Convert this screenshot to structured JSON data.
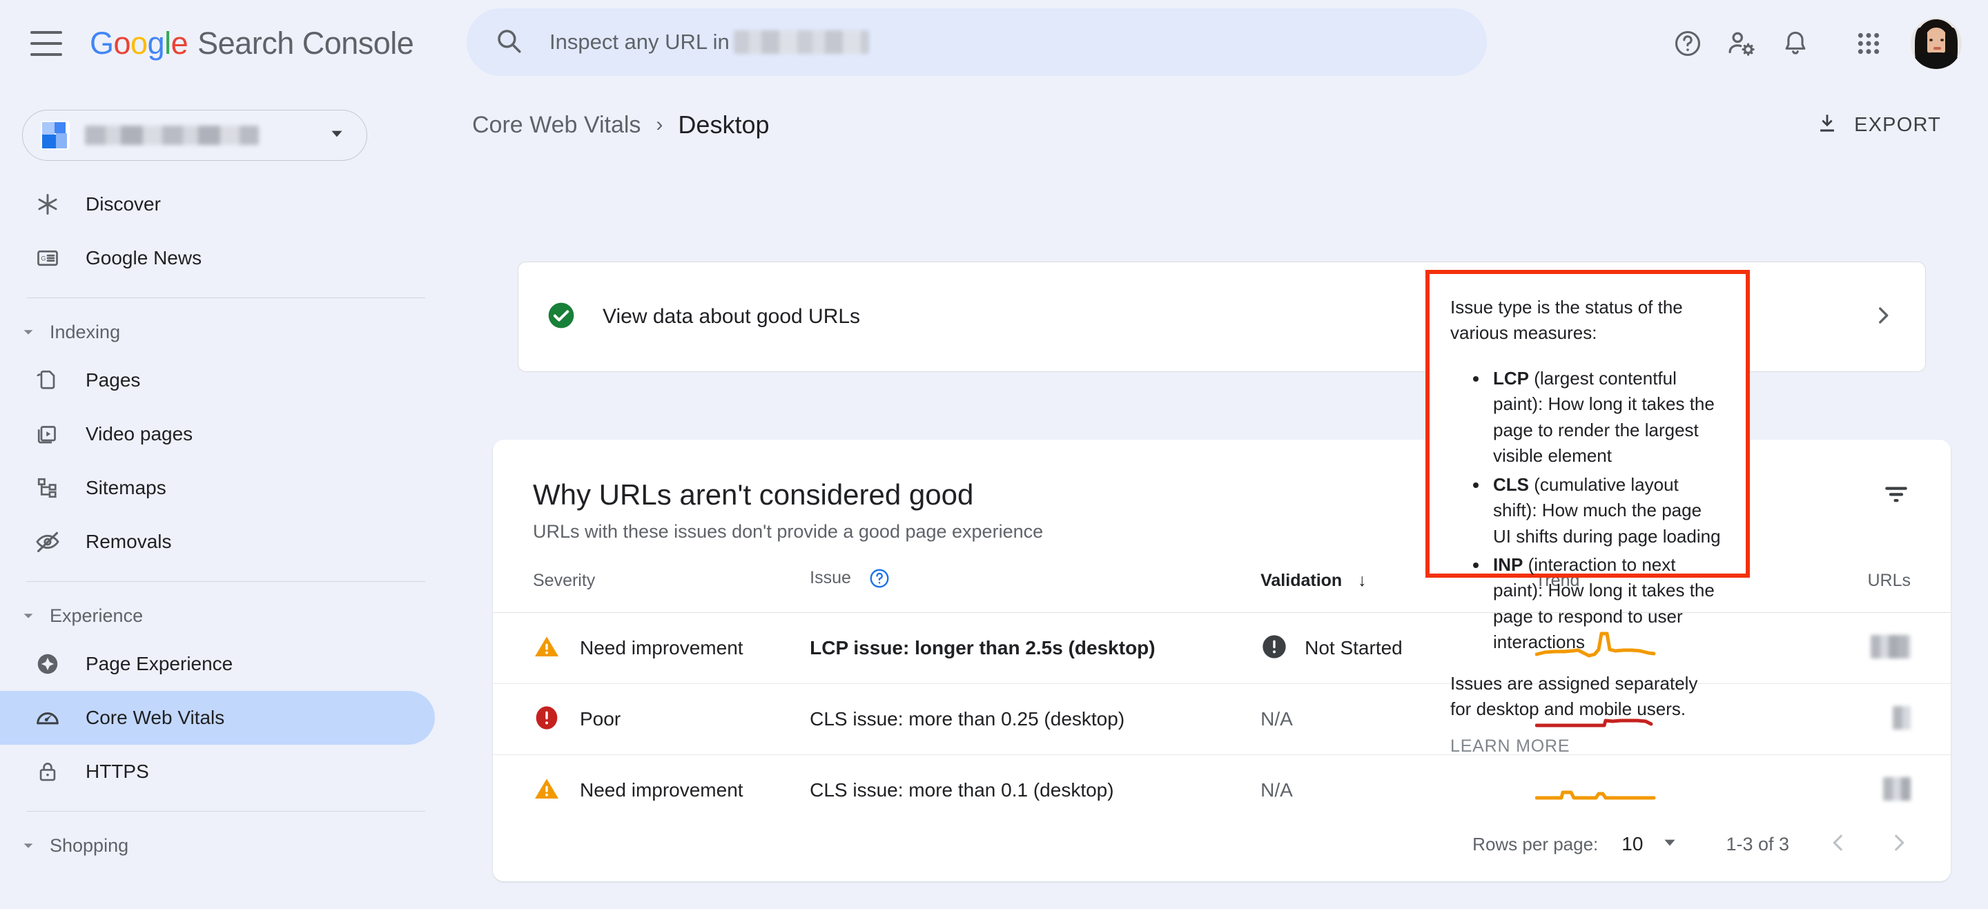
{
  "header": {
    "menu_icon": "hamburger-menu-icon",
    "logo_google": "Google",
    "logo_product": "Search Console",
    "search": {
      "prefix": "Inspect any URL in ",
      "redacted": true,
      "icon": "search-icon"
    },
    "icons": [
      "help-icon",
      "user-settings-icon",
      "notifications-bell-icon",
      "apps-grid-icon"
    ],
    "avatar": "user-avatar"
  },
  "sidebar": {
    "property_selector": {
      "redacted": true,
      "caret": "chevron-down-icon"
    },
    "items": [
      {
        "label": "Discover",
        "icon": "discover-asterisk-icon",
        "active": false
      },
      {
        "label": "Google News",
        "icon": "google-news-icon",
        "active": false
      }
    ],
    "groups": [
      {
        "label": "Indexing",
        "caret": "chevron-down-icon",
        "items": [
          {
            "label": "Pages",
            "icon": "pages-icon",
            "active": false
          },
          {
            "label": "Video pages",
            "icon": "video-pages-icon",
            "active": false
          },
          {
            "label": "Sitemaps",
            "icon": "sitemaps-icon",
            "active": false
          },
          {
            "label": "Removals",
            "icon": "removals-eye-off-icon",
            "active": false
          }
        ]
      },
      {
        "label": "Experience",
        "caret": "chevron-down-icon",
        "items": [
          {
            "label": "Page Experience",
            "icon": "page-experience-icon",
            "active": false
          },
          {
            "label": "Core Web Vitals",
            "icon": "core-web-vitals-speedometer-icon",
            "active": true
          },
          {
            "label": "HTTPS",
            "icon": "https-lock-icon",
            "active": false
          }
        ]
      },
      {
        "label": "Shopping",
        "caret": "chevron-down-icon",
        "items": []
      }
    ]
  },
  "breadcrumb": {
    "parent": "Core Web Vitals",
    "separator": "›",
    "current": "Desktop"
  },
  "export": {
    "label": "EXPORT",
    "icon": "download-icon"
  },
  "good_urls_card": {
    "icon": "check-circle-icon",
    "label": "View data about good URLs",
    "arrow": "chevron-right-icon"
  },
  "issues_table": {
    "title": "Why URLs aren't considered good",
    "subtitle": "URLs with these issues don't provide a good page experience",
    "filter_icon": "filter-icon",
    "headers": [
      {
        "label": "Severity",
        "sorted": false
      },
      {
        "label": "Issue",
        "sorted": false,
        "help_icon": "help-circle-icon"
      },
      {
        "label": "Validation",
        "sorted": true,
        "sort_arrow": "↓"
      },
      {
        "label": "Trend",
        "sorted": false
      },
      {
        "label": "URLs",
        "sorted": false
      }
    ],
    "rows": [
      {
        "severity": "Need improvement",
        "severity_icon": "warning-triangle-icon",
        "severity_color": "#F29900",
        "issue": "LCP issue: longer than 2.5s (desktop)",
        "issue_bold": true,
        "validation": "Not Started",
        "validation_icon": "not-started-icon",
        "trend_color": "#F29900",
        "trend_shape": "spike",
        "urls_redacted": true
      },
      {
        "severity": "Poor",
        "severity_icon": "error-circle-icon",
        "severity_color": "#C5221F",
        "issue": "CLS issue: more than 0.25 (desktop)",
        "issue_bold": false,
        "validation": "N/A",
        "validation_icon": null,
        "trend_color": "#C5221F",
        "trend_shape": "step",
        "urls_redacted": true
      },
      {
        "severity": "Need improvement",
        "severity_icon": "warning-triangle-icon",
        "severity_color": "#F29900",
        "issue": "CLS issue: more than 0.1 (desktop)",
        "issue_bold": false,
        "validation": "N/A",
        "validation_icon": null,
        "trend_color": "#F29900",
        "trend_shape": "flat-bumps",
        "urls_redacted": true
      }
    ],
    "footer": {
      "rows_per_page_label": "Rows per page:",
      "rows_per_page_value": "10",
      "rows_per_page_caret": "caret-down-icon",
      "range": "1-3 of 3",
      "prev_icon": "chevron-left-icon",
      "next_icon": "chevron-right-icon"
    }
  },
  "tooltip": {
    "border_color": "#F3310A",
    "intro": "Issue type is the status of the various measures:",
    "bullets": [
      {
        "term": "LCP",
        "definition": " (largest contentful paint): How long it takes the page to render the largest visible element"
      },
      {
        "term": "CLS",
        "definition": " (cumulative layout shift): How much the page UI shifts during page loading"
      },
      {
        "term": "INP",
        "definition": " (interaction to next paint): How long it takes the page to respond to user interactions"
      }
    ],
    "footer_note": "Issues are assigned separately for desktop and mobile users.",
    "learn_more": "LEARN MORE"
  },
  "colors": {
    "page_bg": "#EEF1FA",
    "card_bg": "#FFFFFF",
    "accent_blue": "#1A73E8",
    "active_nav_bg": "#C2D7FC",
    "warning": "#F29900",
    "error": "#C5221F",
    "success": "#188038"
  }
}
